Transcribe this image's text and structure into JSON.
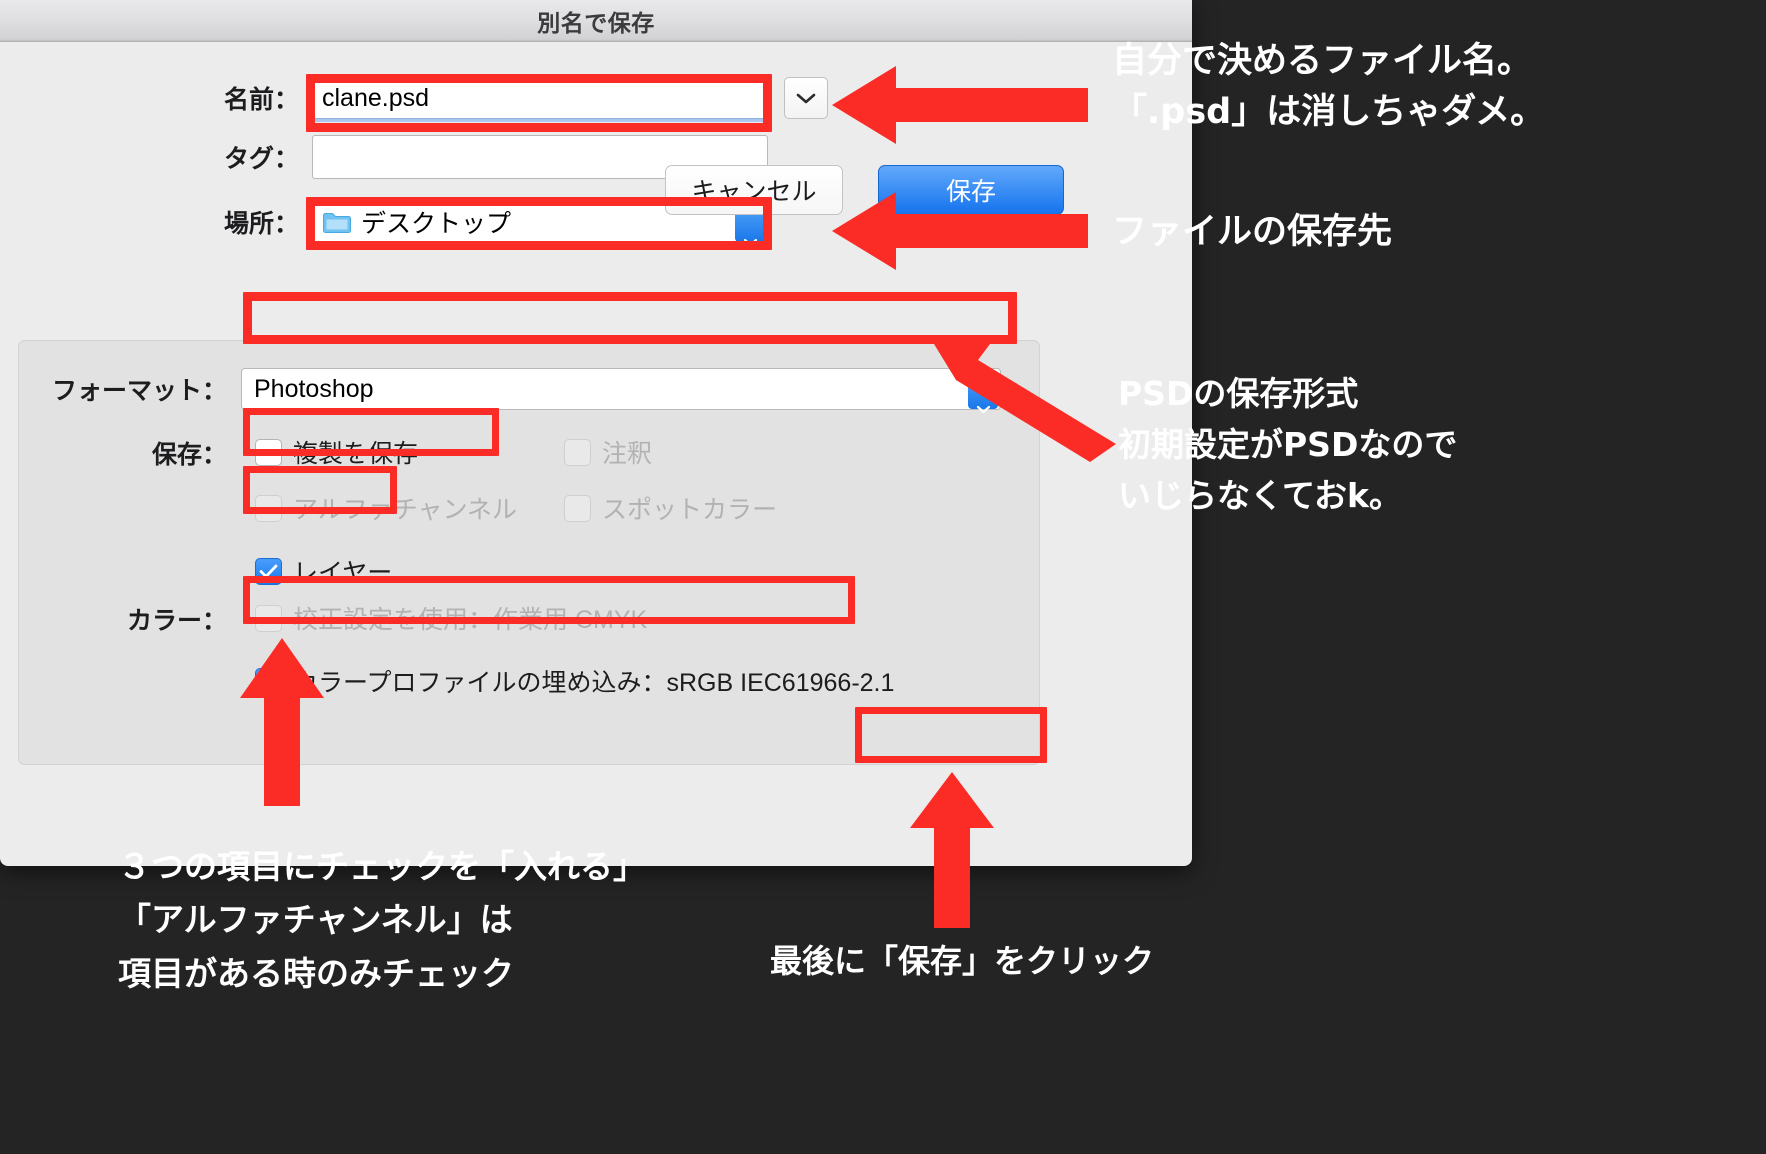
{
  "dialog": {
    "title": "別名で保存",
    "fields": {
      "name_label": "名前：",
      "name_value": "clane.psd",
      "tag_label": "タグ：",
      "tag_value": "",
      "tag_placeholder": "",
      "location_label": "場所：",
      "location_value": "デスクトップ"
    },
    "options": {
      "format_label": "フォーマット：",
      "format_value": "Photoshop",
      "save_label": "保存：",
      "color_label": "カラー：",
      "checkboxes": [
        {
          "id": "save-as-copy",
          "label": "複製を保存",
          "checked": false,
          "disabled": false
        },
        {
          "id": "annotations",
          "label": "注釈",
          "checked": false,
          "disabled": true
        },
        {
          "id": "alpha-channels",
          "label": "アルファチャンネル",
          "checked": false,
          "disabled": true
        },
        {
          "id": "spot-colors",
          "label": "スポットカラー",
          "checked": false,
          "disabled": true
        },
        {
          "id": "layers",
          "label": "レイヤー",
          "checked": true,
          "disabled": false
        },
        {
          "id": "use-proof-setup",
          "label": "校正設定を使用：作業用 CMYK",
          "checked": false,
          "disabled": true
        },
        {
          "id": "embed-profile",
          "label": "カラープロファイルの埋め込み：sRGB IEC61966-2.1",
          "checked": true,
          "disabled": false
        }
      ]
    },
    "buttons": {
      "cancel": "キャンセル",
      "save": "保存"
    }
  },
  "annotations": [
    {
      "id": "filename-note",
      "text": "自分で決めるファイル名。\n「.psd」は消しちゃダメ。"
    },
    {
      "id": "location-note",
      "text": "ファイルの保存先"
    },
    {
      "id": "format-note",
      "text": "PSDの保存形式\n初期設定がPSDなので\nいじらなくておk。"
    },
    {
      "id": "checkboxes-note",
      "text": "３つの項目にチェックを「入れる」\n「アルファチャンネル」は\n項目がある時のみチェック"
    },
    {
      "id": "save-click-note",
      "text": "最後に「保存」をクリック"
    }
  ],
  "colors": {
    "highlight_red": "#fb2b26",
    "accent_blue": "#1573ee",
    "background": "#242424",
    "dialog_bg": "#ececec"
  }
}
